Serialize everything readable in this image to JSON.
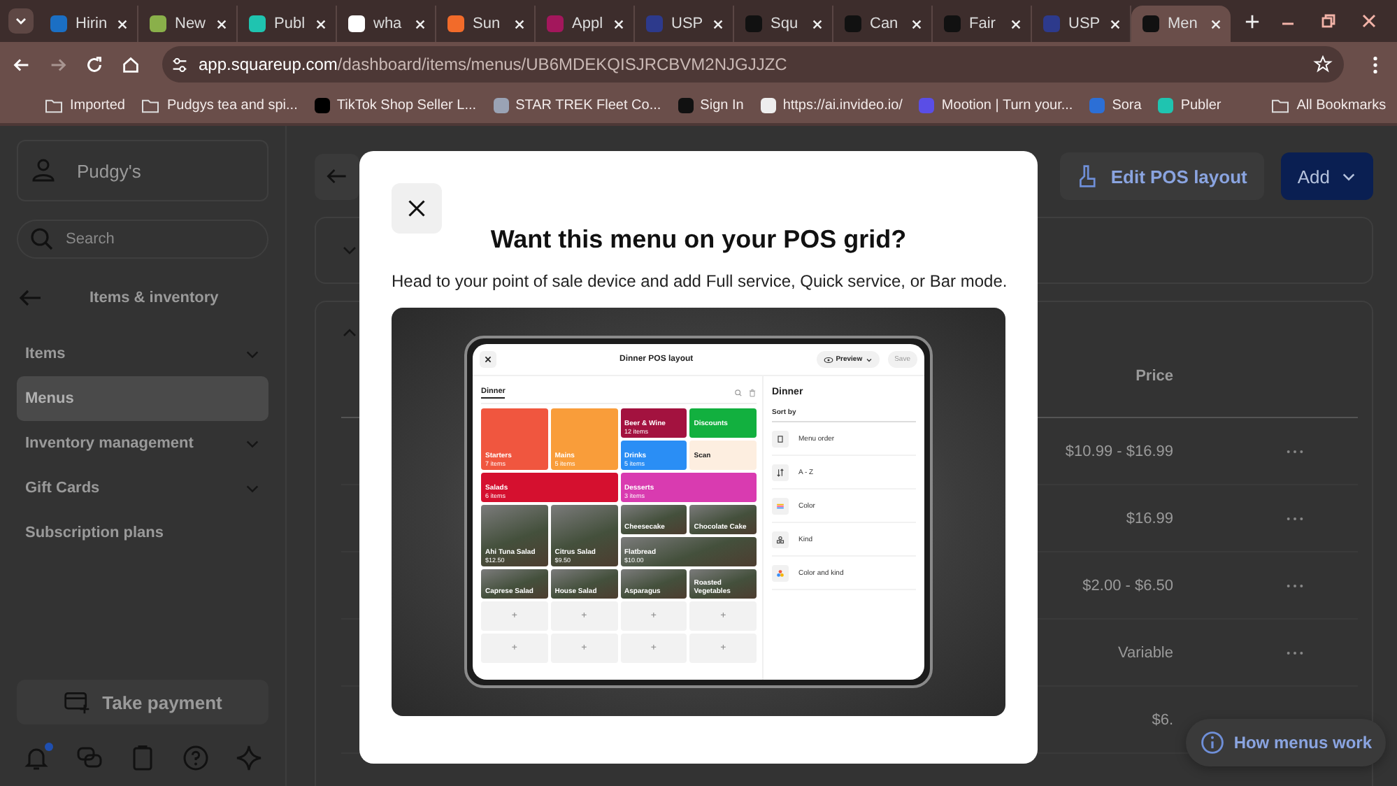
{
  "browser": {
    "tabs": [
      {
        "title": "Hirin",
        "selected": false
      },
      {
        "title": "New",
        "selected": false
      },
      {
        "title": "Publ",
        "selected": false
      },
      {
        "title": "wha",
        "selected": false
      },
      {
        "title": "Sun",
        "selected": false
      },
      {
        "title": "Appl",
        "selected": false
      },
      {
        "title": "USP",
        "selected": false
      },
      {
        "title": "Squ",
        "selected": false
      },
      {
        "title": "Can",
        "selected": false
      },
      {
        "title": "Fair",
        "selected": false
      },
      {
        "title": "USP",
        "selected": false
      },
      {
        "title": "Men",
        "selected": true
      }
    ],
    "url": {
      "host": "app.squareup.com",
      "path": "/dashboard/items/menus/UB6MDEKQISJRCBVM2NJGJJZC"
    },
    "bookmarks": [
      {
        "label": "Imported",
        "kind": "folder"
      },
      {
        "label": "Pudgys tea and spi...",
        "kind": "folder"
      },
      {
        "label": "TikTok Shop Seller L...",
        "kind": "site"
      },
      {
        "label": "STAR TREK Fleet Co...",
        "kind": "site"
      },
      {
        "label": "Sign In",
        "kind": "site"
      },
      {
        "label": "https://ai.invideo.io/",
        "kind": "site"
      },
      {
        "label": "Mootion | Turn your...",
        "kind": "site"
      },
      {
        "label": "Sora",
        "kind": "site"
      },
      {
        "label": "Publer",
        "kind": "site"
      }
    ],
    "all_bookmarks": "All Bookmarks"
  },
  "sidebar": {
    "account": "Pudgy's",
    "search": {
      "placeholder": "Search"
    },
    "section": "Items & inventory",
    "items": [
      {
        "label": "Items",
        "selected": false,
        "expandable": true
      },
      {
        "label": "Menus",
        "selected": true,
        "expandable": false
      },
      {
        "label": "Inventory management",
        "selected": false,
        "expandable": true
      },
      {
        "label": "Gift Cards",
        "selected": false,
        "expandable": true
      },
      {
        "label": "Subscription plans",
        "selected": false,
        "expandable": false
      }
    ],
    "take_payment": "Take payment",
    "notification_badge": true
  },
  "page": {
    "edit_button": "Edit POS layout",
    "add_button": "Add",
    "price_header": "Price",
    "rows": [
      {
        "price": "$10.99 - $16.99"
      },
      {
        "price": "$16.99"
      },
      {
        "price": "$2.00 - $6.50"
      },
      {
        "price": "Variable"
      },
      {
        "price": "$6."
      }
    ],
    "help_button": "How menus work"
  },
  "modal": {
    "title": "Want this menu on your POS grid?",
    "text": "Head to your point of sale device and add Full service, Quick service, or Bar mode.",
    "pos": {
      "title": "Dinner POS layout",
      "preview": "Preview",
      "save": "Save",
      "tab": "Dinner",
      "tiles": [
        {
          "kind": "category",
          "name": "Starters",
          "sub": "7 items",
          "color": "#f0563f"
        },
        {
          "kind": "category",
          "name": "Mains",
          "sub": "5 items",
          "color": "#f99d3a"
        },
        {
          "kind": "category",
          "name": "Beer & Wine",
          "sub": "12 items",
          "color": "#a3123f"
        },
        {
          "kind": "action",
          "name": "Discounts",
          "color": "#12b03f"
        },
        {
          "kind": "category",
          "name": "Drinks",
          "sub": "5 items",
          "color": "#2a8ef5"
        },
        {
          "kind": "action",
          "name": "Scan",
          "color": "#fdeee0"
        },
        {
          "kind": "category",
          "name": "Salads",
          "sub": "6 items",
          "color": "#d5102f"
        },
        {
          "kind": "category",
          "name": "Desserts",
          "sub": "3 items",
          "color": "#d93bb0"
        },
        {
          "kind": "item",
          "name": "Ahi Tuna Salad",
          "sub": "$12.50"
        },
        {
          "kind": "item",
          "name": "Citrus Salad",
          "sub": "$9.50"
        },
        {
          "kind": "item",
          "name": "Cheesecake"
        },
        {
          "kind": "item",
          "name": "Chocolate Cake"
        },
        {
          "kind": "item",
          "name": "Flatbread",
          "sub": "$10.00"
        },
        {
          "kind": "item",
          "name": "Caprese Salad"
        },
        {
          "kind": "item",
          "name": "House Salad"
        },
        {
          "kind": "item",
          "name": "Asparagus"
        },
        {
          "kind": "item",
          "name": "Roasted Vegetables"
        },
        {
          "kind": "empty",
          "name": "+"
        },
        {
          "kind": "empty",
          "name": "+"
        },
        {
          "kind": "empty",
          "name": "+"
        },
        {
          "kind": "empty",
          "name": "+"
        },
        {
          "kind": "empty",
          "name": "+"
        },
        {
          "kind": "empty",
          "name": "+"
        },
        {
          "kind": "empty",
          "name": "+"
        },
        {
          "kind": "empty",
          "name": "+"
        }
      ],
      "panel_title": "Dinner",
      "sort_label": "Sort by",
      "sort_options": [
        {
          "label": "Menu order",
          "kind": "order"
        },
        {
          "label": "A - Z",
          "kind": "alpha"
        },
        {
          "label": "Color",
          "kind": "color"
        },
        {
          "label": "Kind",
          "kind": "kind"
        },
        {
          "label": "Color and kind",
          "kind": "color_kind"
        }
      ]
    }
  }
}
